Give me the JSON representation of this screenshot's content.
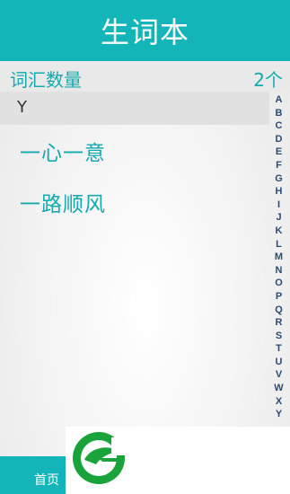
{
  "header": {
    "title": "生词本"
  },
  "stats": {
    "label": "词汇数量",
    "count": "2个"
  },
  "section": {
    "letter": "Y"
  },
  "words": [
    "一心一意",
    "一路顺风"
  ],
  "alphabet": [
    "A",
    "B",
    "C",
    "D",
    "E",
    "F",
    "G",
    "H",
    "I",
    "J",
    "K",
    "L",
    "M",
    "N",
    "O",
    "P",
    "Q",
    "R",
    "S",
    "T",
    "U",
    "V",
    "W",
    "X",
    "Y"
  ],
  "footer": {
    "home_label": "首页"
  },
  "colors": {
    "accent": "#13b5b8",
    "accent_text": "#15a9ad",
    "index_text": "#2d4a72",
    "logo_green": "#1aa33a"
  },
  "icons": {
    "banner_logo": "green-leaf-g-logo-icon"
  }
}
